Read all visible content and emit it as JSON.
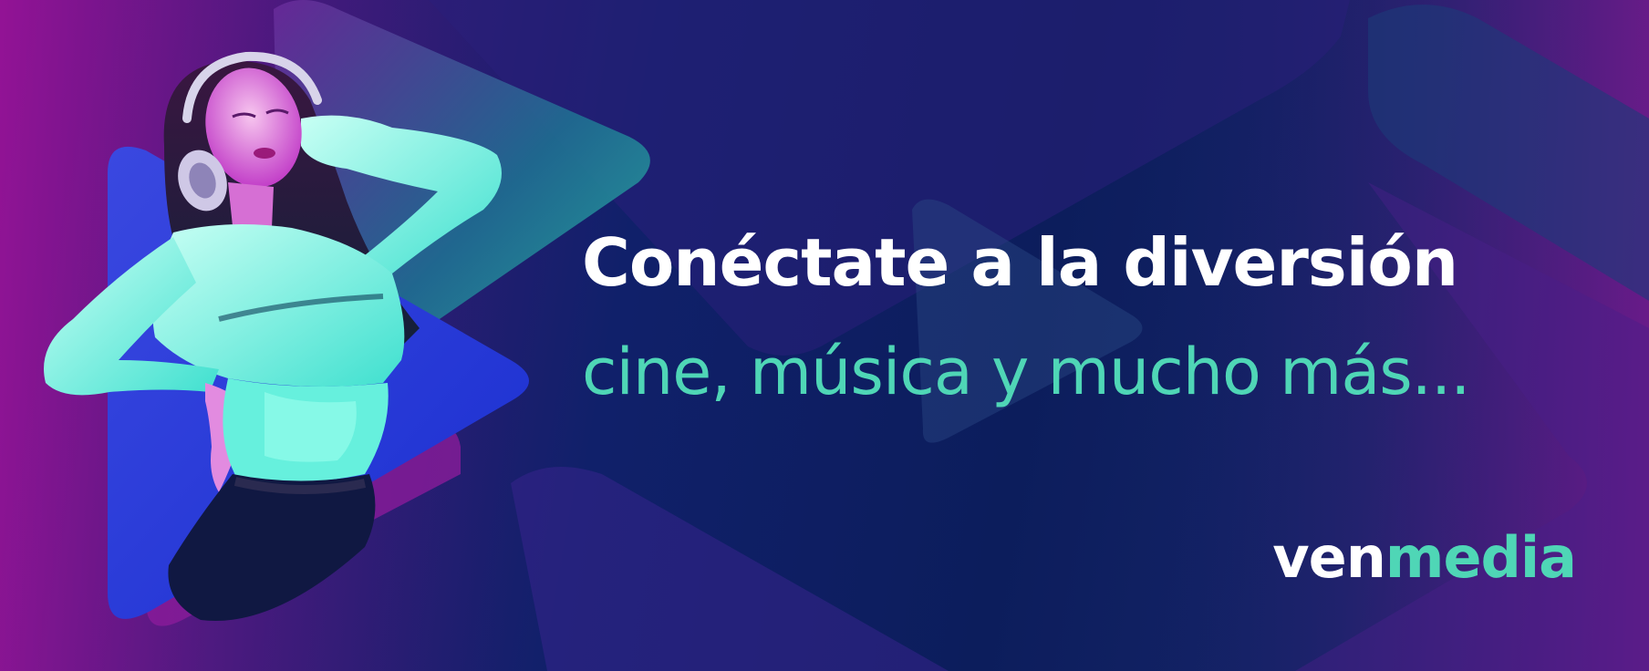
{
  "banner": {
    "headline": "Conéctate a la diversión",
    "subheadline": "cine, música y mucho más...",
    "logo": {
      "part1": "ven",
      "part2": "media"
    },
    "image": "woman-with-headphones-dancing-in-neon-light",
    "decoration": "play-triangle-shapes"
  },
  "colors": {
    "background": "#0f1f5a",
    "accent_teal": "#4fd6b6",
    "accent_magenta": "#b01aa6",
    "headline": "#ffffff"
  }
}
